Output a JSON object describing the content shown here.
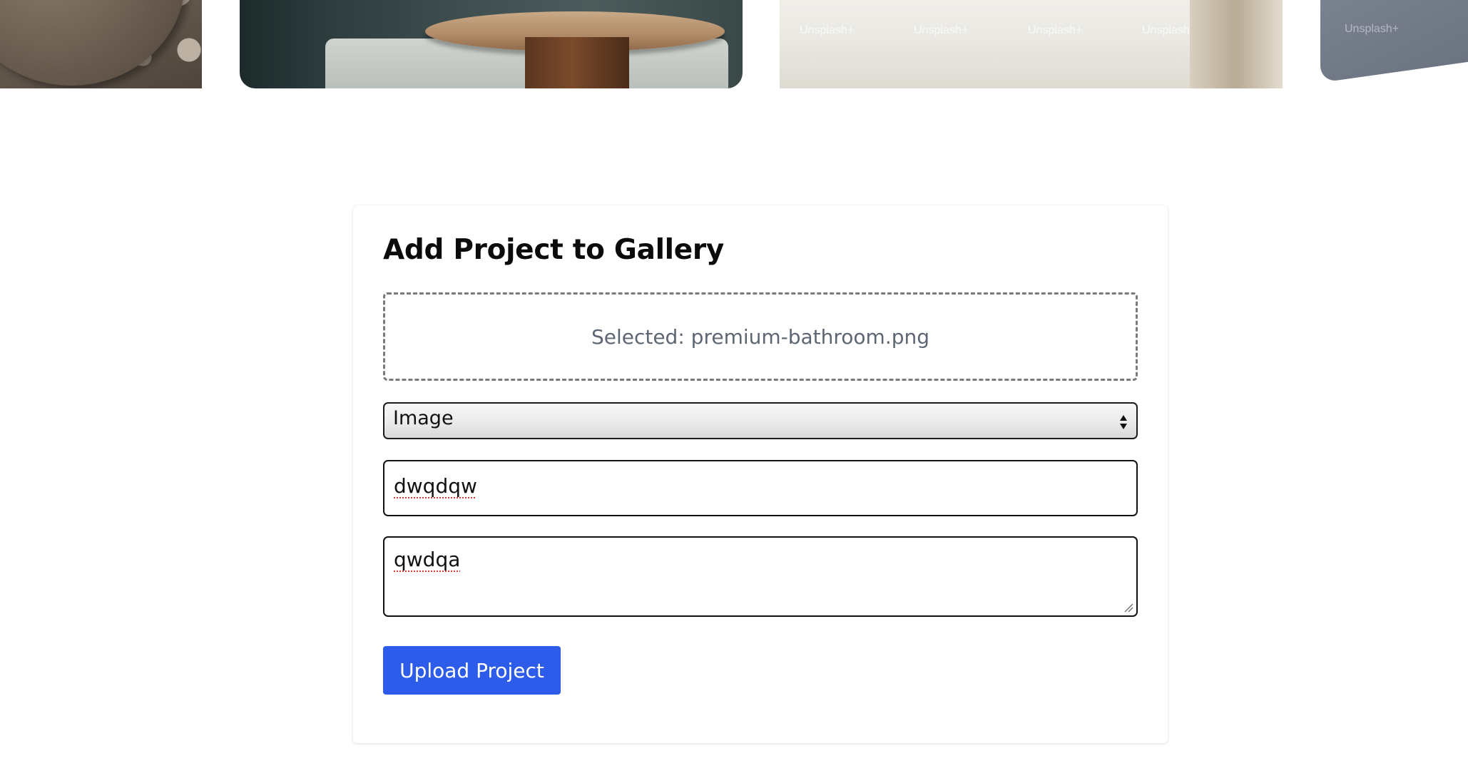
{
  "gallery": {
    "images": [
      {
        "subject": "stone bowl on pebbles"
      },
      {
        "subject": "round wooden coffee table beside sofa"
      },
      {
        "subject": "bright interior floor with doorway",
        "watermarks": [
          "Unsplash+",
          "Unsplash+",
          "Unsplash+",
          "Unsplash+"
        ]
      },
      {
        "subject": "tilted grey card",
        "watermarks": [
          "Unsplash+"
        ]
      }
    ]
  },
  "form": {
    "title": "Add Project to Gallery",
    "dropzone_text": "Selected: premium-bathroom.png",
    "type_select": {
      "selected": "Image"
    },
    "title_input": {
      "value": "dwqdqw"
    },
    "description_textarea": {
      "value": "qwdqa"
    },
    "submit_label": "Upload Project"
  },
  "colors": {
    "primary_button": "#2d5bea",
    "dropzone_border": "#7a7a80",
    "dropzone_text": "#5e6673",
    "spellcheck_underline": "#d33a3a"
  },
  "icons": {
    "select": "select-arrows-icon",
    "textarea": "resize-handle-icon"
  }
}
